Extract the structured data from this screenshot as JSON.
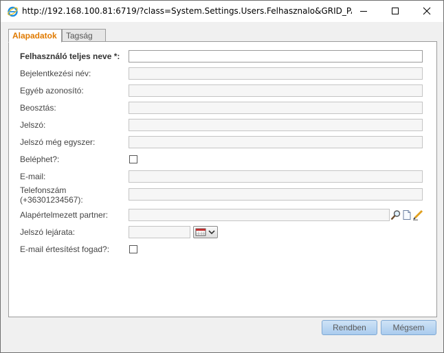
{
  "window": {
    "title": "http://192.168.100.81:6719/?class=System.Settings.Users.Felhasznalo&GRID_PARAMS_JS..."
  },
  "tabs": [
    {
      "label": "Alapadatok",
      "active": true
    },
    {
      "label": "Tagság",
      "active": false
    }
  ],
  "form": {
    "full_name": {
      "label": "Felhasználó teljes neve *:",
      "value": ""
    },
    "login_name": {
      "label": "Bejelentkezési név:",
      "value": ""
    },
    "other_id": {
      "label": "Egyéb azonosító:",
      "value": ""
    },
    "position": {
      "label": "Beosztás:",
      "value": ""
    },
    "password": {
      "label": "Jelszó:",
      "value": ""
    },
    "password_again": {
      "label": "Jelszó még egyszer:",
      "value": ""
    },
    "can_login": {
      "label": "Beléphet?:",
      "checked": false
    },
    "email": {
      "label": "E-mail:",
      "value": ""
    },
    "phone": {
      "label_line1": "Telefonszám",
      "label_line2": "(+36301234567):",
      "value": ""
    },
    "default_partner": {
      "label": "Alapértelmezett partner:",
      "value": ""
    },
    "password_expiry": {
      "label": "Jelszó lejárata:",
      "value": ""
    },
    "email_notify": {
      "label": "E-mail értesítést fogad?:",
      "checked": false
    }
  },
  "buttons": {
    "ok": "Rendben",
    "cancel": "Mégsem"
  },
  "colors": {
    "active_tab": "#e07a00",
    "button_bg": "#a9cbee"
  }
}
